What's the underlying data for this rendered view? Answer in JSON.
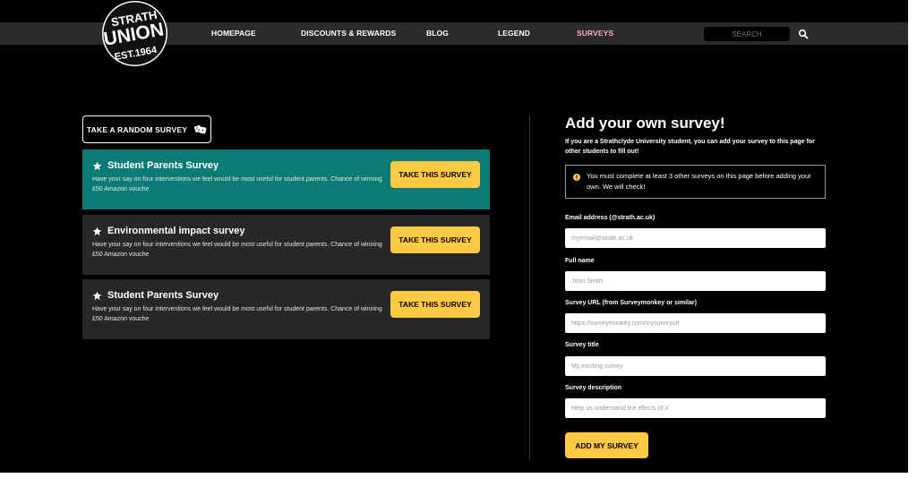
{
  "nav": {
    "items": [
      {
        "label": "HOMEPAGE",
        "active": false
      },
      {
        "label": "DISCOUNTS & REWARDS",
        "active": false
      },
      {
        "label": "BLOG",
        "active": false
      },
      {
        "label": "LEGEND",
        "active": false
      },
      {
        "label": "SURVEYS",
        "active": true
      }
    ],
    "search_placeholder": "SEARCH"
  },
  "logo": {
    "line1": "STRATH",
    "line2": "UNION",
    "line3": "EST.1964"
  },
  "random_button": {
    "label": "TAKE A RANDOM SURVEY",
    "icon": "dice-icon"
  },
  "surveys": [
    {
      "title": "Student Parents Survey",
      "description": "Have your say on four interventions we feel would be most useful for student parents. Chance of winning £50 Amazon vouche",
      "button": "TAKE THIS SURVEY",
      "featured": true
    },
    {
      "title": "Environmental impact survey",
      "description": "Have your say on four interventions we feel would be most useful for student parents. Chance of winning £50 Amazon vouche",
      "button": "TAKE THIS SURVEY",
      "featured": false
    },
    {
      "title": "Student Parents Survey",
      "description": "Have your say on four interventions we feel would be most useful for student parents. Chance of winning £50 Amazon vouche",
      "button": "TAKE THIS SURVEY",
      "featured": false
    }
  ],
  "form": {
    "title": "Add your own survey!",
    "subtitle": "If you are a Strathclyde University student, you can add your survey to this page for other students to fill out!",
    "notice": "You must complete at least 3 other surveys on this page before adding your own. We will check!",
    "fields": [
      {
        "label": "Email address (@strath.ac.uk)",
        "placeholder": "myemail@strath.ac.uk",
        "value": ""
      },
      {
        "label": "Full name",
        "placeholder": "John Smith",
        "value": ""
      },
      {
        "label": "Survey URL (from Surveymonkey or similar)",
        "placeholder": "https://surveymonkey.com/mysurveyurl",
        "value": ""
      },
      {
        "label": "Survey title",
        "placeholder": "My exciting survey",
        "value": ""
      },
      {
        "label": "Survey description",
        "placeholder": "Help us understand the effects of X",
        "value": ""
      }
    ],
    "submit_label": "ADD MY SURVEY"
  },
  "colors": {
    "accent": "#ffc845",
    "featured_card": "#0b7b76",
    "card": "#272727",
    "nav_bar": "#2b2b2b",
    "active_nav": "#f7a8d2"
  }
}
